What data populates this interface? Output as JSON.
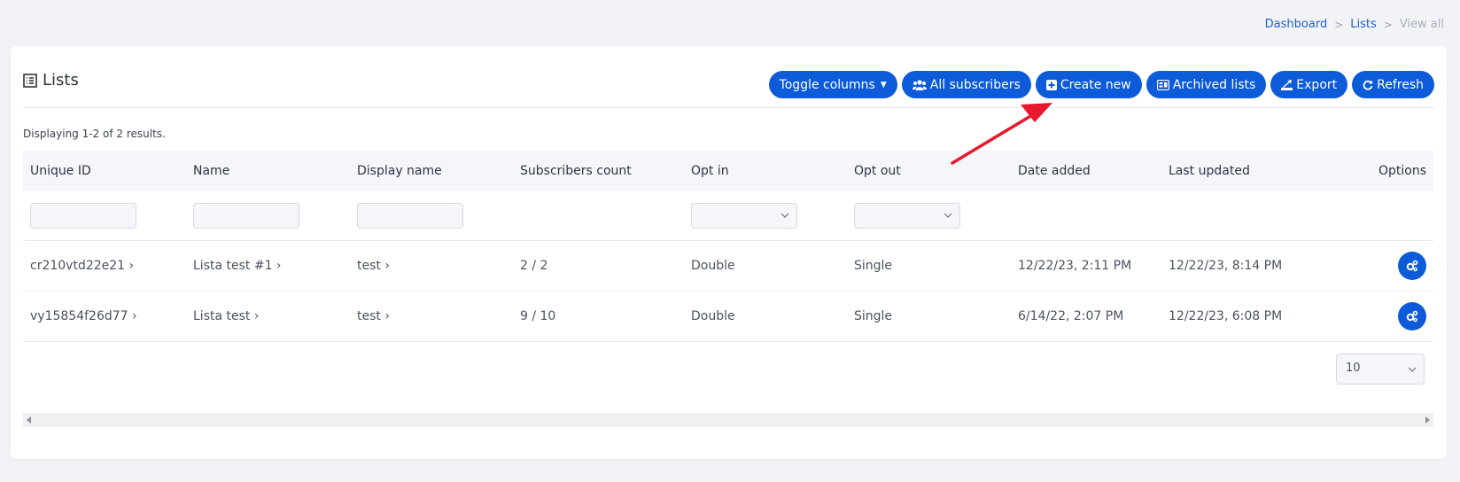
{
  "breadcrumb": {
    "dashboard": "Dashboard",
    "lists": "Lists",
    "current": "View all",
    "sep": ">"
  },
  "card": {
    "title": "Lists"
  },
  "toolbar": {
    "toggle_columns": "Toggle columns",
    "all_subscribers": "All subscribers",
    "create_new": "Create new",
    "archived_lists": "Archived lists",
    "export": "Export",
    "refresh": "Refresh"
  },
  "summary": "Displaying 1-2 of 2 results.",
  "table": {
    "headers": [
      "Unique ID",
      "Name",
      "Display name",
      "Subscribers count",
      "Opt in",
      "Opt out",
      "Date added",
      "Last updated",
      "Options"
    ],
    "rows": [
      {
        "uid": "cr210vtd22e21 ›",
        "name": "Lista test #1 ›",
        "display_name": "test ›",
        "subscribers": "2 / 2",
        "opt_in": "Double",
        "opt_out": "Single",
        "date_added": "12/22/23, 2:11 PM",
        "last_updated": "12/22/23, 8:14 PM"
      },
      {
        "uid": "vy15854f26d77 ›",
        "name": "Lista test ›",
        "display_name": "test ›",
        "subscribers": "9 / 10",
        "opt_in": "Double",
        "opt_out": "Single",
        "date_added": "6/14/22, 2:07 PM",
        "last_updated": "12/22/23, 6:08 PM"
      }
    ]
  },
  "page_size": "10",
  "colors": {
    "primary": "#0d5bd8",
    "annotation_arrow": "#e8192c"
  }
}
